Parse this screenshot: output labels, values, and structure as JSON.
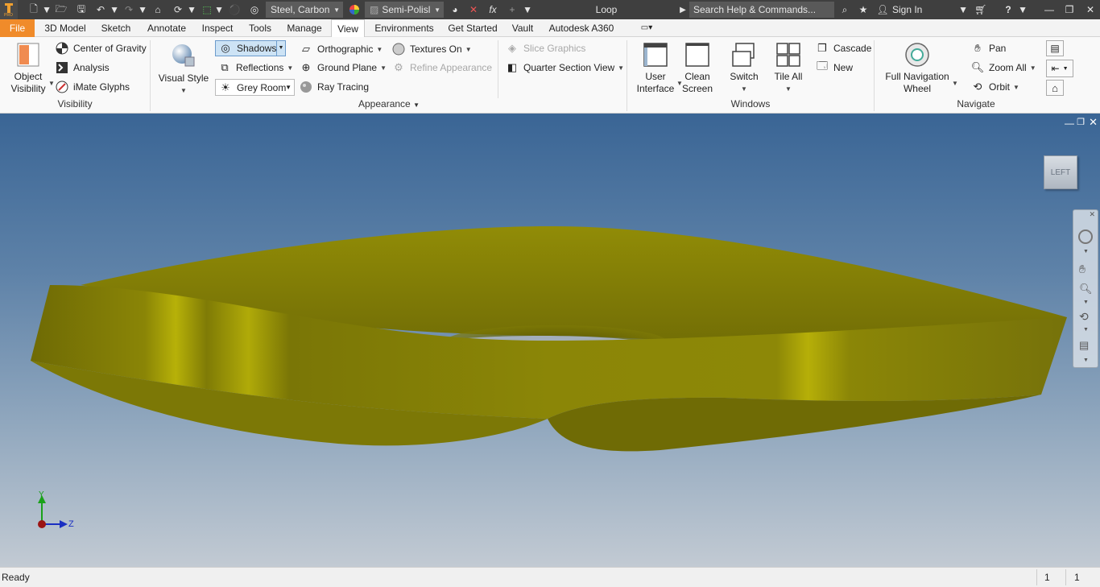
{
  "title_bar": {
    "material": "Steel, Carbon",
    "appearance": "Semi-Polisl",
    "doc_title": "Loop",
    "search_placeholder": "Search Help & Commands...",
    "sign_in": "Sign In"
  },
  "tabs": [
    "File",
    "3D Model",
    "Sketch",
    "Annotate",
    "Inspect",
    "Tools",
    "Manage",
    "View",
    "Environments",
    "Get Started",
    "Vault",
    "Autodesk A360"
  ],
  "active_tab": "View",
  "ribbon": {
    "visibility": {
      "object_visibility": "Object\nVisibility",
      "center_of_gravity": "Center of Gravity",
      "analysis": "Analysis",
      "imate_glyphs": "iMate Glyphs",
      "title": "Visibility"
    },
    "appearance": {
      "visual_style": "Visual Style",
      "shadows": "Shadows",
      "reflections": "Reflections",
      "grey_room": "Grey Room",
      "orthographic": "Orthographic",
      "ground_plane": "Ground Plane",
      "ray_tracing": "Ray Tracing",
      "textures_on": "Textures On",
      "refine_appearance": "Refine Appearance",
      "slice_graphics": "Slice Graphics",
      "quarter_section_view": "Quarter Section View",
      "title": "Appearance"
    },
    "windows": {
      "user_interface": "User\nInterface",
      "clean_screen": "Clean\nScreen",
      "switch": "Switch",
      "tile_all": "Tile All",
      "cascade": "Cascade",
      "new": "New",
      "title": "Windows"
    },
    "navigate": {
      "full_navigation_wheel": "Full Navigation\nWheel",
      "pan": "Pan",
      "zoom_all": "Zoom All",
      "orbit": "Orbit",
      "title": "Navigate"
    }
  },
  "viewport": {
    "viewcube_label": "LEFT",
    "axis_y": "Y",
    "axis_z": "Z",
    "model_color": "#8f8a07",
    "bg_top": "#3a6595",
    "bg_bottom": "#c2cad3"
  },
  "status": {
    "text": "Ready",
    "count1": "1",
    "count2": "1"
  }
}
